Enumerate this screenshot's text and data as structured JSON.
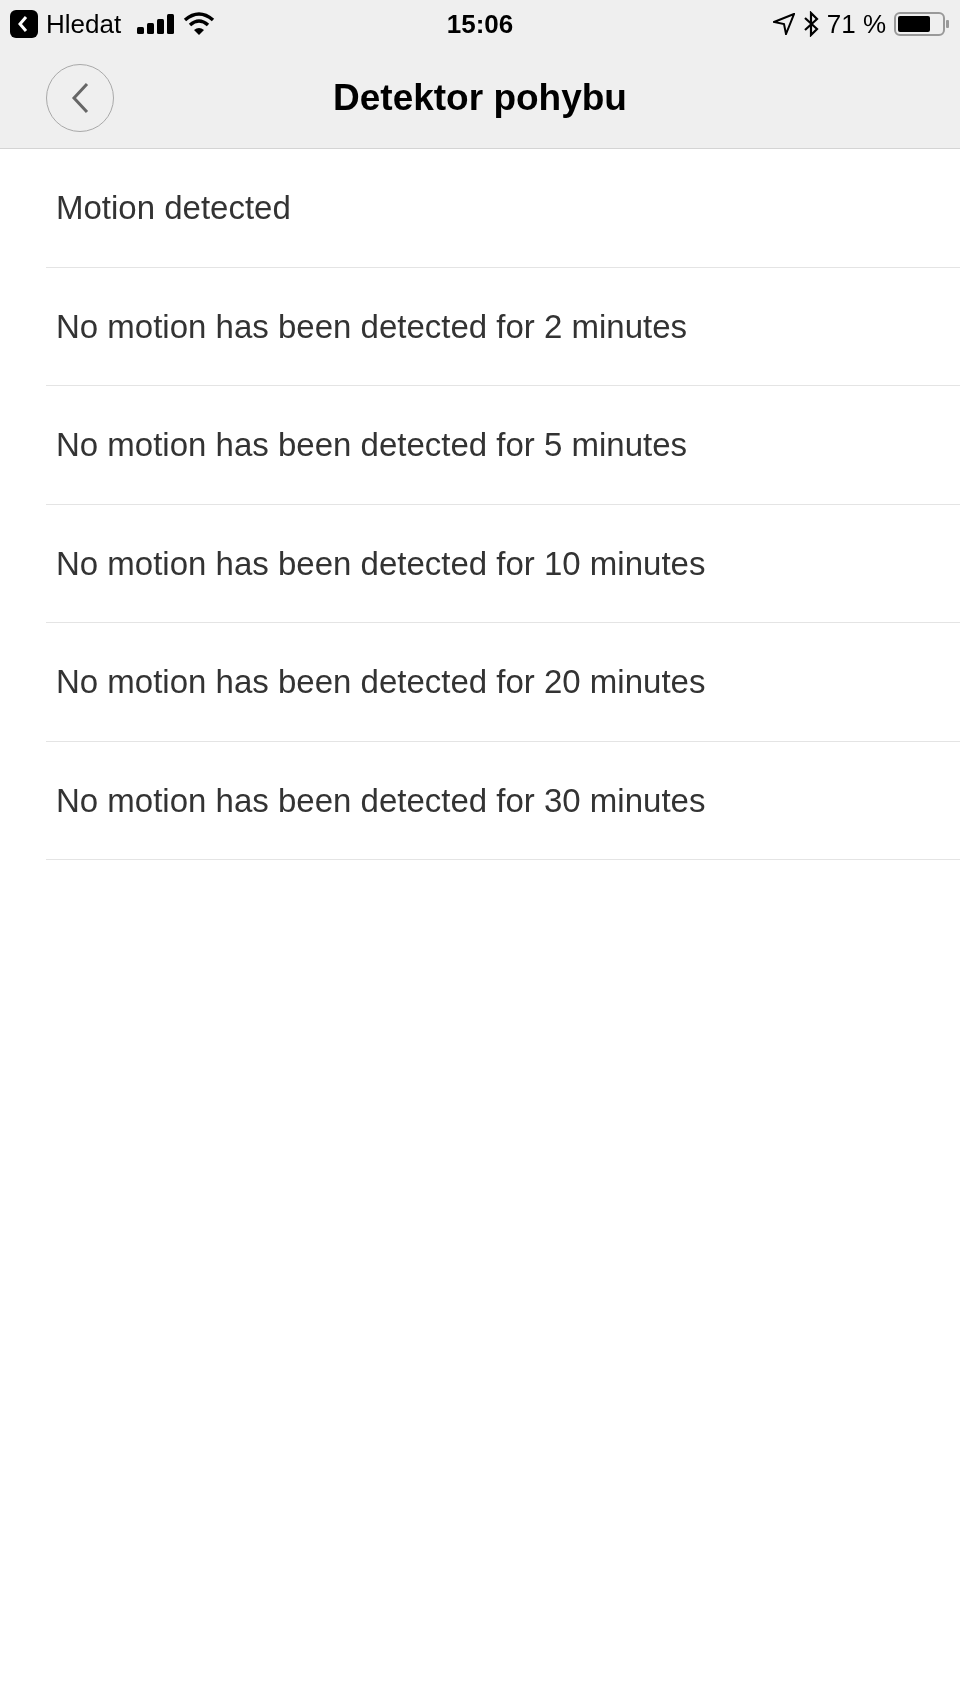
{
  "status_bar": {
    "back_app": "Hledat",
    "time": "15:06",
    "battery": "71 %"
  },
  "nav": {
    "title": "Detektor pohybu"
  },
  "items": [
    {
      "label": "Motion detected"
    },
    {
      "label": "No motion has been detected for 2 minutes"
    },
    {
      "label": "No motion has been detected for 5 minutes"
    },
    {
      "label": "No motion has been detected for 10 minutes"
    },
    {
      "label": "No motion has been detected for 20 minutes"
    },
    {
      "label": "No motion has been detected for 30 minutes"
    }
  ]
}
